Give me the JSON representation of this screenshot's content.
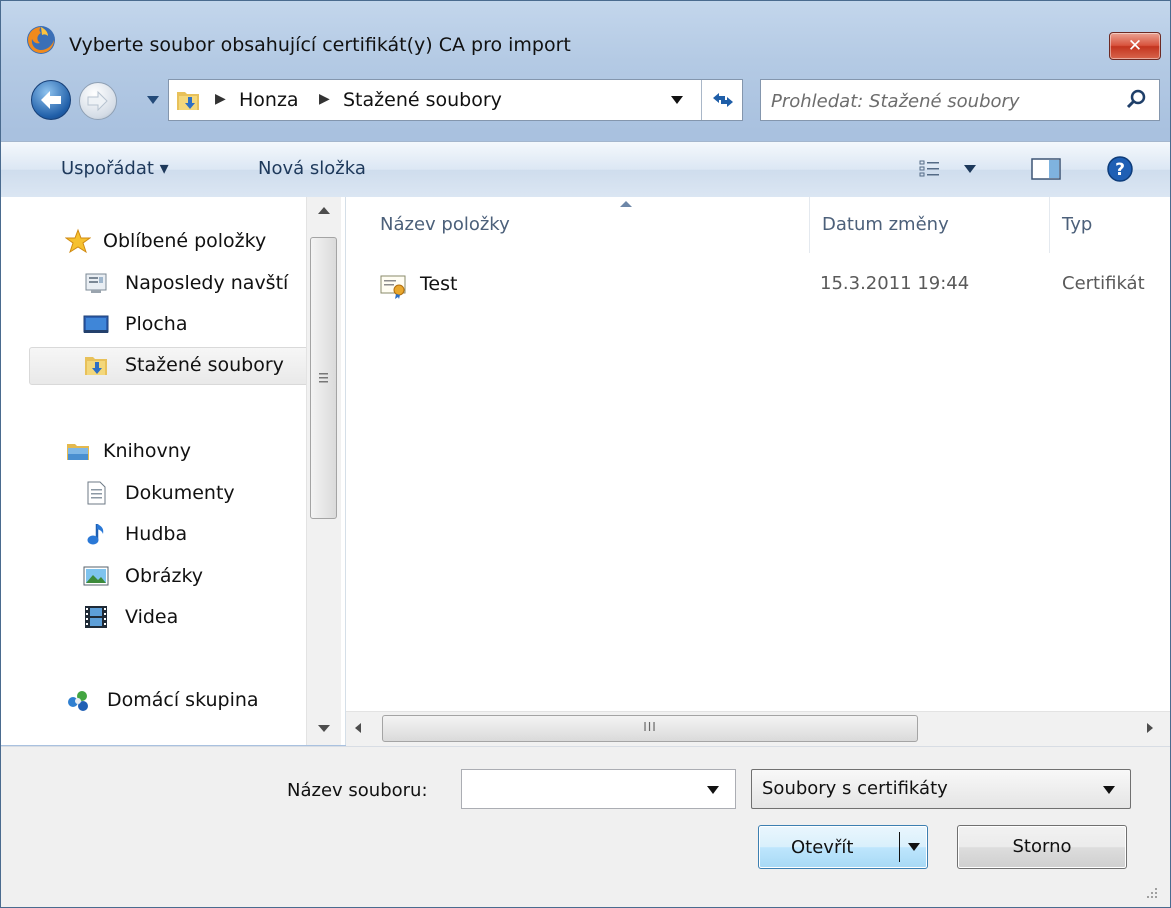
{
  "window": {
    "title": "Vyberte soubor obsahující certifikát(y) CA pro import",
    "close_label": "✕"
  },
  "address": {
    "segments": [
      "Honza",
      "Stažené soubory"
    ]
  },
  "search": {
    "placeholder": "Prohledat: Stažené soubory"
  },
  "toolbar": {
    "organize_label": "Uspořádat ▾",
    "new_folder_label": "Nová složka"
  },
  "nav": {
    "favorites": "Oblíbené položky",
    "recent": "Naposledy navští",
    "desktop": "Plocha",
    "downloads": "Stažené soubory",
    "libraries": "Knihovny",
    "documents": "Dokumenty",
    "music": "Hudba",
    "pictures": "Obrázky",
    "videos": "Videa",
    "homegroup": "Domácí skupina"
  },
  "columns": {
    "name": "Název položky",
    "date": "Datum změny",
    "type": "Typ"
  },
  "files": [
    {
      "name": "Test",
      "date": "15.3.2011 19:44",
      "type": "Certifikát"
    }
  ],
  "hscroll_glyph": "III",
  "footer": {
    "filename_label": "Název souboru:",
    "filename_value": "",
    "filetype_value": "Soubory s certifikáty",
    "open_label": "Otevřít",
    "cancel_label": "Storno"
  },
  "colors": {
    "accent": "#3c7fb1",
    "selection": "#e9e9e9",
    "frame": "#b4cae4",
    "close": "#c3341f"
  }
}
